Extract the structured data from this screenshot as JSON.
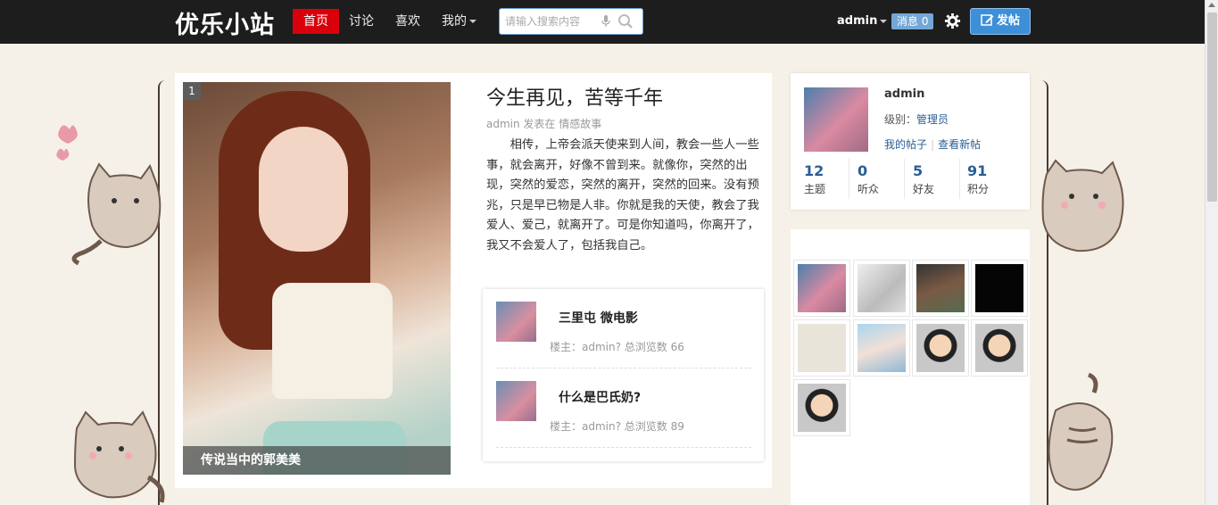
{
  "topbar": {
    "logo": "优乐小站",
    "nav": [
      {
        "label": "首页",
        "active": true
      },
      {
        "label": "讨论"
      },
      {
        "label": "喜欢"
      },
      {
        "label": "我的"
      }
    ],
    "search": {
      "placeholder": "请输入搜索内容"
    },
    "user": "admin",
    "messages": "消息 0",
    "post_button": "发帖"
  },
  "featured": {
    "index": "1",
    "caption": "传说当中的郭美美",
    "title": "今生再见，苦等千年",
    "meta": "admin 发表在 情感故事",
    "body": "相传，上帝会派天使来到人间，教会一些人一些事，就会离开，好像不曾到来。就像你，突然的出现，突然的爱恋，突然的离开，突然的回来。没有预兆，只是早已物是人非。你就是我的天使，教会了我爱人、爱己，就离开了。可是你知道吗，你离开了，我又不会爱人了，包括我自己。"
  },
  "related": [
    {
      "title": "三里屯 微电影",
      "meta": "楼主：admin? 总浏览数 66"
    },
    {
      "title": "什么是巴氏奶?",
      "meta": "楼主：admin? 总浏览数 89"
    }
  ],
  "profile": {
    "name": "admin",
    "level_label": "级别：",
    "level": "管理员",
    "my_posts": "我的帖子",
    "new_posts": "查看新帖",
    "stats": [
      {
        "value": "12",
        "label": "主题"
      },
      {
        "value": "0",
        "label": "听众"
      },
      {
        "value": "5",
        "label": "好友"
      },
      {
        "value": "91",
        "label": "积分"
      }
    ]
  },
  "gallery_count": 9,
  "colors": {
    "accent": "#d9000b",
    "link": "#2a5e94",
    "post_button": "#3d8fd8",
    "topbar": "#1d1d1d"
  }
}
